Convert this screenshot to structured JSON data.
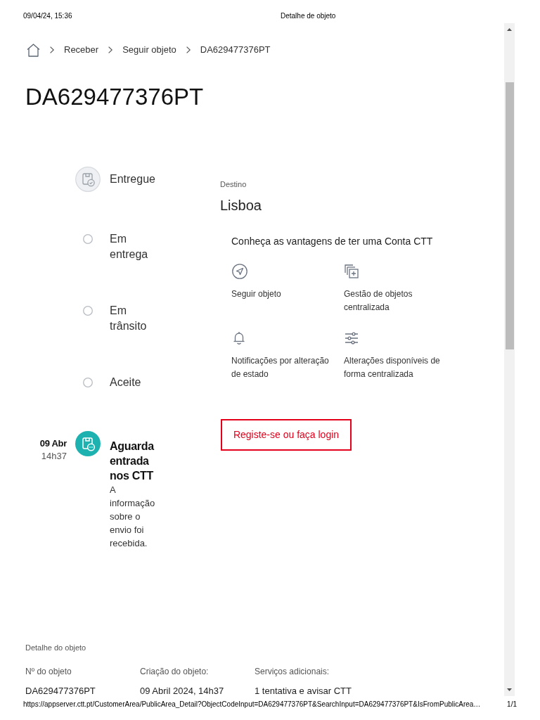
{
  "print_header": {
    "date_time": "09/04/24, 15:36",
    "title": "Detalhe de objeto"
  },
  "breadcrumb": [
    {
      "label": "Receber"
    },
    {
      "label": "Seguir objeto"
    },
    {
      "label": "DA629477376PT"
    }
  ],
  "title": "DA629477376PT",
  "timeline": [
    {
      "kind": "final",
      "label": "Entregue"
    },
    {
      "kind": "pending",
      "label": "Em entrega"
    },
    {
      "kind": "pending",
      "label": "Em trânsito"
    },
    {
      "kind": "pending",
      "label": "Aceite"
    },
    {
      "kind": "event",
      "date": "09 Abr",
      "time": "14h37",
      "label": "Aguarda entrada nos CTT",
      "description": "A informação sobre o envio foi recebida."
    }
  ],
  "destination": {
    "label": "Destino",
    "value": "Lisboa"
  },
  "account_promo": {
    "heading": "Conheça as vantagens de ter uma Conta CTT",
    "benefits": [
      {
        "kind": "track",
        "label": "Seguir objeto"
      },
      {
        "kind": "manage",
        "label": "Gestão de objetos centralizada"
      },
      {
        "kind": "notify",
        "label": "Notificações por alteração de estado"
      },
      {
        "kind": "settings",
        "label": "Alterações disponíveis de forma centralizada"
      }
    ],
    "button": "Registe-se ou faça login"
  },
  "object_detail": {
    "heading": "Detalhe do objeto",
    "fields": [
      {
        "label": "Nº do objeto",
        "value": "DA629477376PT"
      },
      {
        "label": "Criação do objeto:",
        "value": "09 Abril 2024, 14h37"
      },
      {
        "label": "Serviços adicionais:",
        "value": "1 tentativa e avisar CTT"
      }
    ]
  },
  "print_footer": {
    "url": "https://appserver.ctt.pt/CustomerArea/PublicArea_Detail?ObjectCodeInput=DA629477376PT&SearchInput=DA629477376PT&IsFromPublicArea…",
    "page": "1/1"
  }
}
